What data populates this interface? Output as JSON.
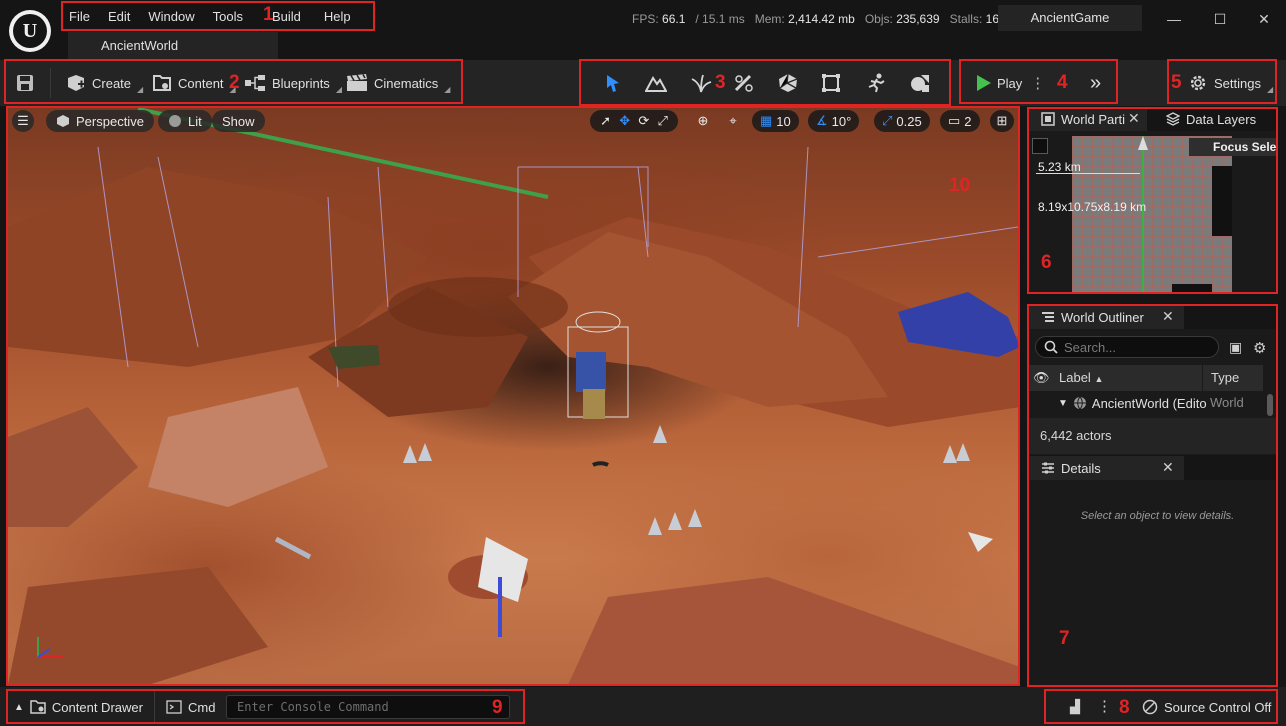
{
  "app": {
    "logo_letter": "U",
    "menu": [
      "File",
      "Edit",
      "Window",
      "Tools",
      "Build",
      "Help"
    ],
    "level_tab": "AncientWorld",
    "project_name": "AncientGame",
    "stats": {
      "fps_label": "FPS:",
      "fps_value": "66.1",
      "ms": "/ 15.1 ms",
      "mem_label": "Mem:",
      "mem_value": "2,414.42 mb",
      "objs_label": "Objs:",
      "objs_value": "235,639",
      "stalls_label": "Stalls:",
      "stalls_value": "16"
    },
    "window_controls": {
      "minimize": "—",
      "maximize": "☐",
      "close": "✕"
    }
  },
  "toolbar": {
    "create": "Create",
    "content": "Content",
    "blueprints": "Blueprints",
    "cinematics": "Cinematics",
    "play": "Play",
    "settings": "Settings",
    "modes": [
      "select-mode",
      "landscape-mode",
      "foliage-mode",
      "mesh-paint-mode",
      "fracture-mode",
      "brush-edit-mode",
      "animation-mode",
      "modeling-mode"
    ]
  },
  "viewport": {
    "perspective": "Perspective",
    "lit": "Lit",
    "show": "Show",
    "grid_snap": "10",
    "rotation_snap": "10°",
    "scale_snap": "0.25",
    "camera_speed": "2"
  },
  "world_partition": {
    "tab_label": "World Parti",
    "data_layers_tab": "Data Layers",
    "focus_button": "Focus Sele",
    "scale_label": "5.23 km",
    "dimensions": "8.19x10.75x8.19 km"
  },
  "outliner": {
    "tab_label": "World Outliner",
    "search_placeholder": "Search...",
    "col_label": "Label",
    "col_type": "Type",
    "row_label": "AncientWorld (Edito",
    "row_type": "World",
    "actor_count": "6,442 actors"
  },
  "details": {
    "tab_label": "Details",
    "empty_message": "Select an object to view details."
  },
  "statusbar": {
    "content_drawer": "Content Drawer",
    "cmd": "Cmd",
    "console_placeholder": "Enter Console Command",
    "source_control": "Source Control Off"
  },
  "annotations": [
    "1",
    "2",
    "3",
    "4",
    "5",
    "6",
    "7",
    "8",
    "9",
    "10"
  ],
  "colors": {
    "accent_play": "#45c24d",
    "annotation": "#e02424",
    "mode_active": "#2f8fff",
    "panel_bg": "#1a1a1a"
  }
}
